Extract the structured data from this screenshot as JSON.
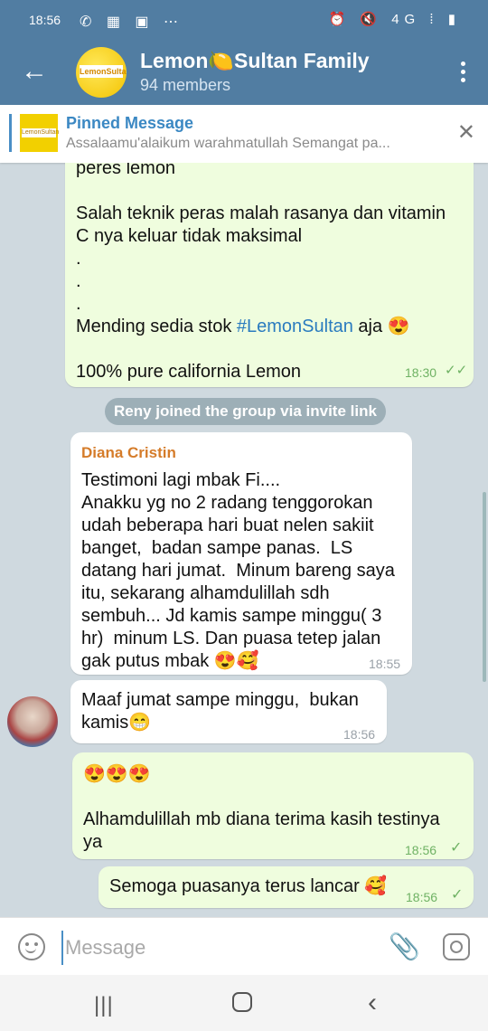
{
  "status_bar": {
    "time": "18:56",
    "left_icons": "✆ ▦ ▣ ⋯",
    "right_icons": "⏰ 🔇 4G ⁞ ▮"
  },
  "header": {
    "title": "Lemon🍋Sultan Family",
    "subtitle": "94 members",
    "avatar_text": "LemonSultan"
  },
  "pinned": {
    "title": "Pinned Message",
    "text": "Assalaamu'alaikum warahmatullah  Semangat pa...",
    "thumb_text": "LemonSultan"
  },
  "messages": [
    {
      "text_before": "peres lemon\n\nSalah teknik peras malah rasanya dan vitamin C nya keluar tidak maksimal\n.\n.\n.\nMending sedia stok ",
      "hashtag": "#LemonSultan",
      "text_after": " aja 😍\n\n100% pure california Lemon",
      "time": "18:30",
      "read": "✓✓"
    },
    {
      "service": "Reny joined the group via invite link"
    },
    {
      "sender": "Diana Cristin",
      "text": "Testimoni lagi mbak Fi....\nAnakku yg no 2 radang tenggorokan udah beberapa hari buat nelen sakiit banget,  badan sampe panas.  LS datang hari jumat.  Minum bareng saya itu, sekarang alhamdulillah sdh sembuh... Jd kamis sampe minggu( 3 hr)  minum LS. Dan puasa tetep jalan gak putus mbak 😍🥰",
      "time": "18:55"
    },
    {
      "text": "Maaf jumat sampe minggu,  bukan kamis😁",
      "time": "18:56"
    },
    {
      "text": "😍😍😍\n\nAlhamdulillah mb diana terima kasih testinya ya",
      "time": "18:56",
      "read": "✓"
    },
    {
      "text": "Semoga puasanya terus lancar 🥰",
      "time": "18:56",
      "read": "✓"
    }
  ],
  "input": {
    "placeholder": "Message"
  },
  "colors": {
    "header": "#517da2",
    "outgoing": "#effdde",
    "incoming": "#ffffff",
    "sender": "#d57c2a",
    "link": "#2a7bbf"
  },
  "icons": [
    "back-arrow-icon",
    "more-vert-icon",
    "close-icon",
    "emoji-icon",
    "attach-icon",
    "camera-icon",
    "nav-recents-icon",
    "nav-home-icon",
    "nav-back-icon"
  ]
}
